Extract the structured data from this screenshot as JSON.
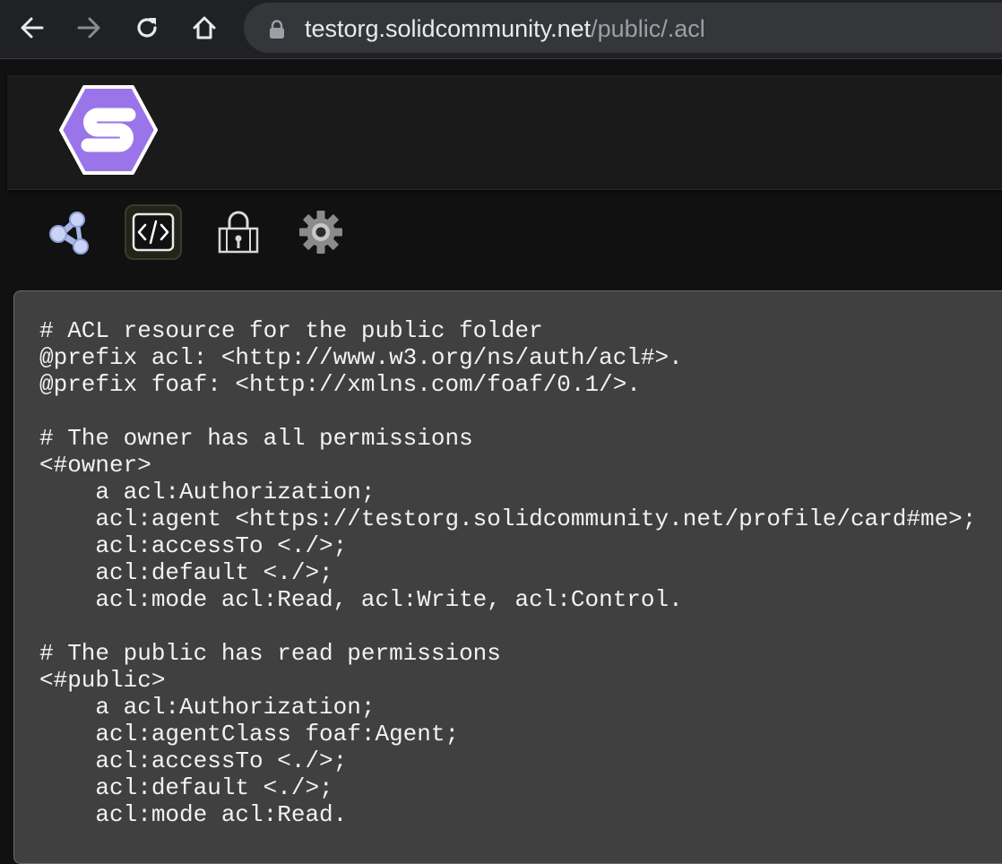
{
  "browser": {
    "url_host": "testorg.solidcommunity.net",
    "url_path": "/public/.acl",
    "icons": [
      "back-arrow-icon",
      "forward-arrow-icon",
      "reload-icon",
      "home-icon",
      "lock-icon"
    ]
  },
  "app": {
    "logo": "solid-logo-icon",
    "accent_color": "#9a75e9",
    "panes": [
      {
        "name": "graph-pane-icon",
        "selected": false
      },
      {
        "name": "source-pane-icon",
        "selected": true
      },
      {
        "name": "sharing-pane-icon",
        "selected": false
      },
      {
        "name": "settings-pane-icon",
        "selected": false
      }
    ]
  },
  "source": {
    "lines": [
      "# ACL resource for the public folder",
      "@prefix acl: <http://www.w3.org/ns/auth/acl#>.",
      "@prefix foaf: <http://xmlns.com/foaf/0.1/>.",
      "",
      "# The owner has all permissions",
      "<#owner>",
      "    a acl:Authorization;",
      "    acl:agent <https://testorg.solidcommunity.net/profile/card#me>;",
      "    acl:accessTo <./>;",
      "    acl:default <./>;",
      "    acl:mode acl:Read, acl:Write, acl:Control.",
      "",
      "# The public has read permissions",
      "<#public>",
      "    a acl:Authorization;",
      "    acl:agentClass foaf:Agent;",
      "    acl:accessTo <./>;",
      "    acl:default <./>;",
      "    acl:mode acl:Read."
    ]
  }
}
